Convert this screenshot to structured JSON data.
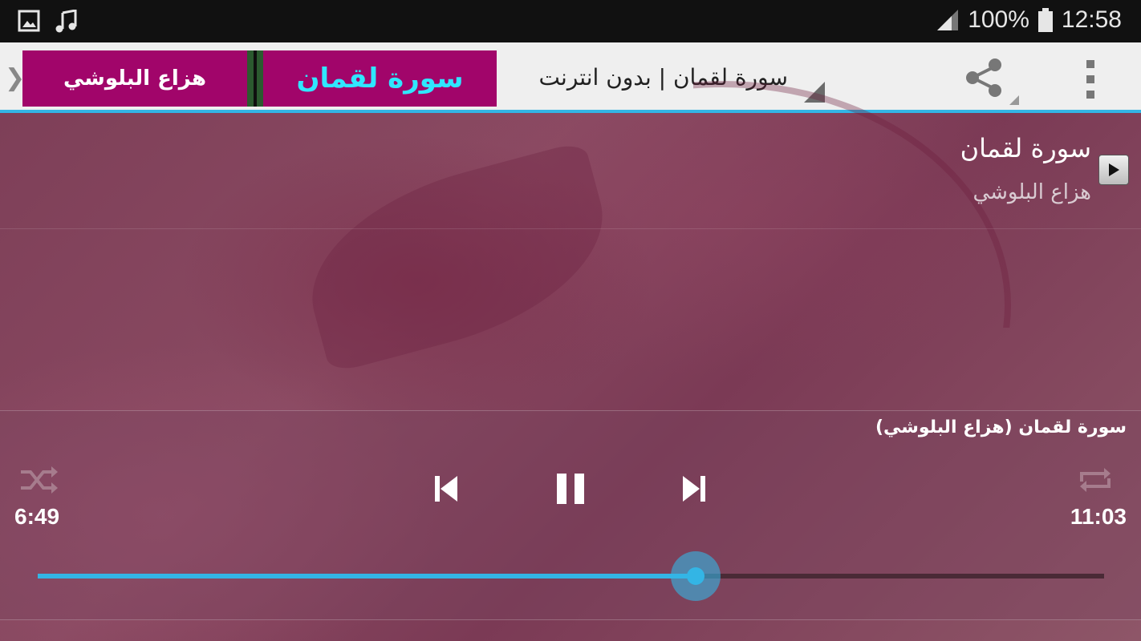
{
  "status_bar": {
    "battery": "100%",
    "time": "12:58",
    "icons": [
      "gallery-icon",
      "music-note-icon",
      "signal-icon",
      "battery-icon"
    ]
  },
  "action_bar": {
    "banner_right_text": "سورة لقمان",
    "banner_left_text": "هزاع البلوشي",
    "title": "سورة لقمان | بدون انترنت",
    "back_glyph": "❯",
    "icons": [
      "share-icon",
      "overflow-menu-icon"
    ]
  },
  "track": {
    "title": "سورة لقمان",
    "artist": "هزاع البلوشي"
  },
  "player": {
    "now_playing": "سورة لقمان (هزاع البلوشي)",
    "elapsed": "6:49",
    "duration": "11:03",
    "progress": 0.617,
    "icons": [
      "shuffle-icon",
      "previous-icon",
      "pause-icon",
      "next-icon",
      "repeat-icon"
    ]
  },
  "colors": {
    "accent": "#33b5e5",
    "banner_bg": "#a1056a",
    "banner_highlight": "#2fe7ff"
  }
}
